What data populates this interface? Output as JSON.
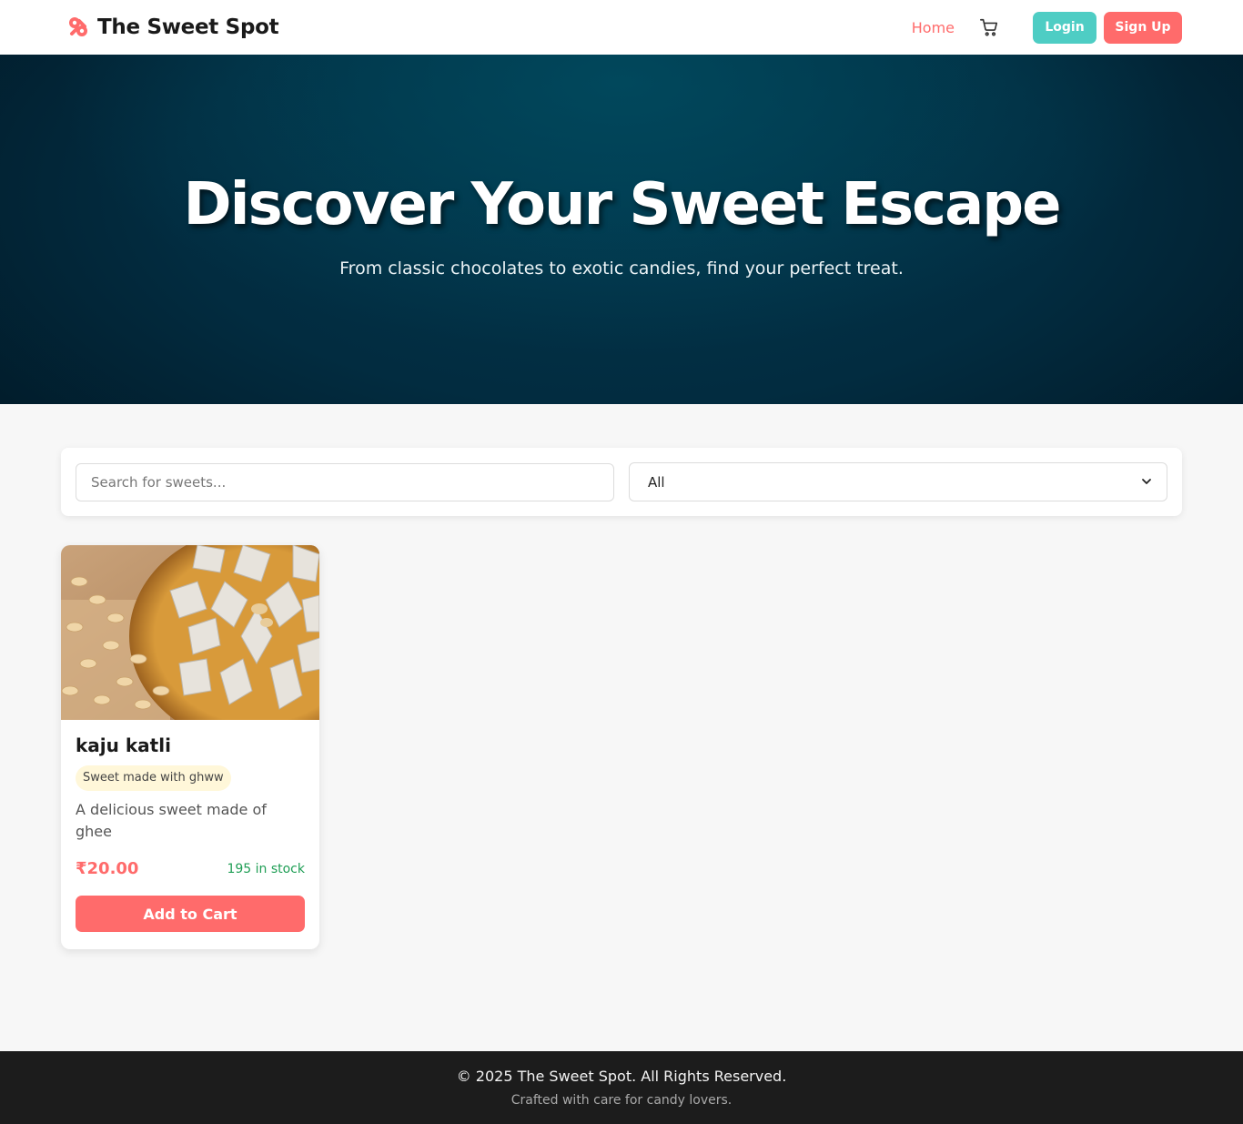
{
  "header": {
    "brand_name": "The Sweet Spot",
    "brand_icon": "candy-icon",
    "nav_home": "Home",
    "cart_icon": "cart-icon",
    "login_label": "Login",
    "signup_label": "Sign Up"
  },
  "hero": {
    "title": "Discover Your Sweet Escape",
    "subtitle": "From classic chocolates to exotic candies, find your perfect treat."
  },
  "filters": {
    "search_placeholder": "Search for sweets...",
    "search_value": "",
    "category_selected": "All"
  },
  "products": [
    {
      "name": "kaju katli",
      "tag": "Sweet made with ghww",
      "description": "A delicious sweet made of ghee",
      "price": "₹20.00",
      "stock": "195 in stock",
      "button_label": "Add to Cart"
    }
  ],
  "footer": {
    "copyright": "© 2025 The Sweet Spot. All Rights Reserved.",
    "tagline": "Crafted with care for candy lovers."
  },
  "colors": {
    "accent": "#ff6b6b",
    "teal": "#4ecdc4",
    "hero_bg": "#022c40",
    "stock_green": "#1f9e55",
    "footer_bg": "#1c1c1c"
  }
}
